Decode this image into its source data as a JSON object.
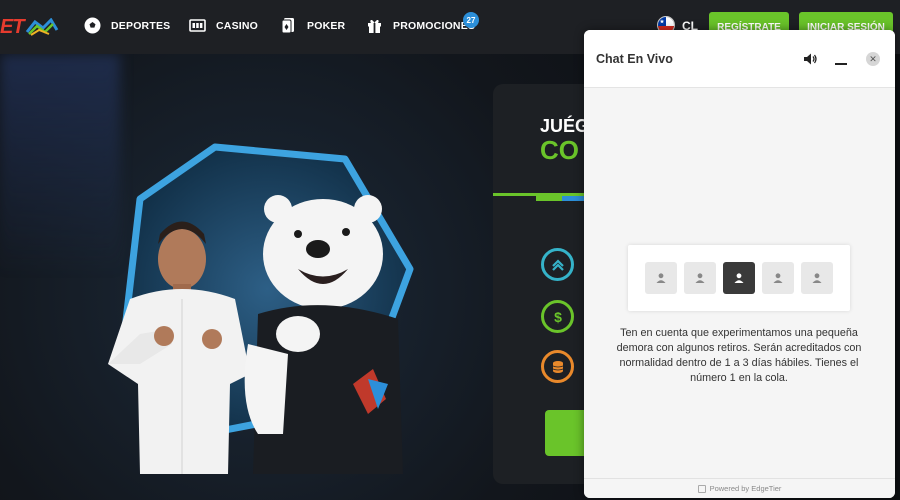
{
  "nav": {
    "logo_text": "ET",
    "items": [
      {
        "label": "DEPORTES",
        "icon": "soccer-ball-icon"
      },
      {
        "label": "CASINO",
        "icon": "slot-machine-icon"
      },
      {
        "label": "POKER",
        "icon": "cards-icon"
      },
      {
        "label": "PROMOCIONES",
        "icon": "gift-icon"
      }
    ],
    "promo_count": "27",
    "country_code": "CL",
    "register_label": "REGÍSTRATE",
    "login_label": "INICIAR SESIÓN"
  },
  "hero": {
    "card_title_line1": "JUÉG",
    "card_title_line2": "CO"
  },
  "chat": {
    "title": "Chat En Vivo",
    "message": "Ten en cuenta que experimentamos una pequeña demora con algunos retiros. Serán acreditados con normalidad dentro de 1 a 3 días hábiles. Tienes el número 1 en la cola.",
    "queue_slots": 5,
    "queue_active_index": 2,
    "footer": "Powered by EdgeTier"
  },
  "colors": {
    "accent_green": "#6ac42a",
    "accent_blue": "#2c8fd9",
    "logo_red": "#e63b2e",
    "nav_bg": "#1e2024"
  }
}
